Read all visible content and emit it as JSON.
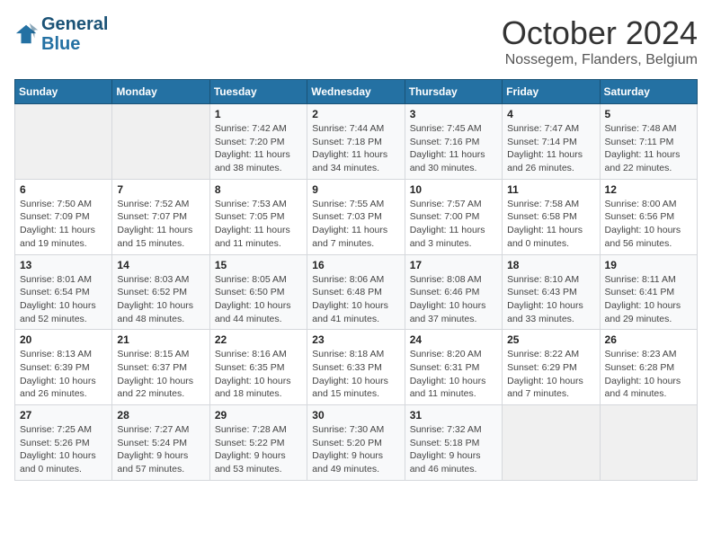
{
  "header": {
    "logo_line1": "General",
    "logo_line2": "Blue",
    "month": "October 2024",
    "location": "Nossegem, Flanders, Belgium"
  },
  "weekdays": [
    "Sunday",
    "Monday",
    "Tuesday",
    "Wednesday",
    "Thursday",
    "Friday",
    "Saturday"
  ],
  "weeks": [
    [
      {
        "day": "",
        "info": ""
      },
      {
        "day": "",
        "info": ""
      },
      {
        "day": "1",
        "info": "Sunrise: 7:42 AM\nSunset: 7:20 PM\nDaylight: 11 hours and 38 minutes."
      },
      {
        "day": "2",
        "info": "Sunrise: 7:44 AM\nSunset: 7:18 PM\nDaylight: 11 hours and 34 minutes."
      },
      {
        "day": "3",
        "info": "Sunrise: 7:45 AM\nSunset: 7:16 PM\nDaylight: 11 hours and 30 minutes."
      },
      {
        "day": "4",
        "info": "Sunrise: 7:47 AM\nSunset: 7:14 PM\nDaylight: 11 hours and 26 minutes."
      },
      {
        "day": "5",
        "info": "Sunrise: 7:48 AM\nSunset: 7:11 PM\nDaylight: 11 hours and 22 minutes."
      }
    ],
    [
      {
        "day": "6",
        "info": "Sunrise: 7:50 AM\nSunset: 7:09 PM\nDaylight: 11 hours and 19 minutes."
      },
      {
        "day": "7",
        "info": "Sunrise: 7:52 AM\nSunset: 7:07 PM\nDaylight: 11 hours and 15 minutes."
      },
      {
        "day": "8",
        "info": "Sunrise: 7:53 AM\nSunset: 7:05 PM\nDaylight: 11 hours and 11 minutes."
      },
      {
        "day": "9",
        "info": "Sunrise: 7:55 AM\nSunset: 7:03 PM\nDaylight: 11 hours and 7 minutes."
      },
      {
        "day": "10",
        "info": "Sunrise: 7:57 AM\nSunset: 7:00 PM\nDaylight: 11 hours and 3 minutes."
      },
      {
        "day": "11",
        "info": "Sunrise: 7:58 AM\nSunset: 6:58 PM\nDaylight: 11 hours and 0 minutes."
      },
      {
        "day": "12",
        "info": "Sunrise: 8:00 AM\nSunset: 6:56 PM\nDaylight: 10 hours and 56 minutes."
      }
    ],
    [
      {
        "day": "13",
        "info": "Sunrise: 8:01 AM\nSunset: 6:54 PM\nDaylight: 10 hours and 52 minutes."
      },
      {
        "day": "14",
        "info": "Sunrise: 8:03 AM\nSunset: 6:52 PM\nDaylight: 10 hours and 48 minutes."
      },
      {
        "day": "15",
        "info": "Sunrise: 8:05 AM\nSunset: 6:50 PM\nDaylight: 10 hours and 44 minutes."
      },
      {
        "day": "16",
        "info": "Sunrise: 8:06 AM\nSunset: 6:48 PM\nDaylight: 10 hours and 41 minutes."
      },
      {
        "day": "17",
        "info": "Sunrise: 8:08 AM\nSunset: 6:46 PM\nDaylight: 10 hours and 37 minutes."
      },
      {
        "day": "18",
        "info": "Sunrise: 8:10 AM\nSunset: 6:43 PM\nDaylight: 10 hours and 33 minutes."
      },
      {
        "day": "19",
        "info": "Sunrise: 8:11 AM\nSunset: 6:41 PM\nDaylight: 10 hours and 29 minutes."
      }
    ],
    [
      {
        "day": "20",
        "info": "Sunrise: 8:13 AM\nSunset: 6:39 PM\nDaylight: 10 hours and 26 minutes."
      },
      {
        "day": "21",
        "info": "Sunrise: 8:15 AM\nSunset: 6:37 PM\nDaylight: 10 hours and 22 minutes."
      },
      {
        "day": "22",
        "info": "Sunrise: 8:16 AM\nSunset: 6:35 PM\nDaylight: 10 hours and 18 minutes."
      },
      {
        "day": "23",
        "info": "Sunrise: 8:18 AM\nSunset: 6:33 PM\nDaylight: 10 hours and 15 minutes."
      },
      {
        "day": "24",
        "info": "Sunrise: 8:20 AM\nSunset: 6:31 PM\nDaylight: 10 hours and 11 minutes."
      },
      {
        "day": "25",
        "info": "Sunrise: 8:22 AM\nSunset: 6:29 PM\nDaylight: 10 hours and 7 minutes."
      },
      {
        "day": "26",
        "info": "Sunrise: 8:23 AM\nSunset: 6:28 PM\nDaylight: 10 hours and 4 minutes."
      }
    ],
    [
      {
        "day": "27",
        "info": "Sunrise: 7:25 AM\nSunset: 5:26 PM\nDaylight: 10 hours and 0 minutes."
      },
      {
        "day": "28",
        "info": "Sunrise: 7:27 AM\nSunset: 5:24 PM\nDaylight: 9 hours and 57 minutes."
      },
      {
        "day": "29",
        "info": "Sunrise: 7:28 AM\nSunset: 5:22 PM\nDaylight: 9 hours and 53 minutes."
      },
      {
        "day": "30",
        "info": "Sunrise: 7:30 AM\nSunset: 5:20 PM\nDaylight: 9 hours and 49 minutes."
      },
      {
        "day": "31",
        "info": "Sunrise: 7:32 AM\nSunset: 5:18 PM\nDaylight: 9 hours and 46 minutes."
      },
      {
        "day": "",
        "info": ""
      },
      {
        "day": "",
        "info": ""
      }
    ]
  ]
}
